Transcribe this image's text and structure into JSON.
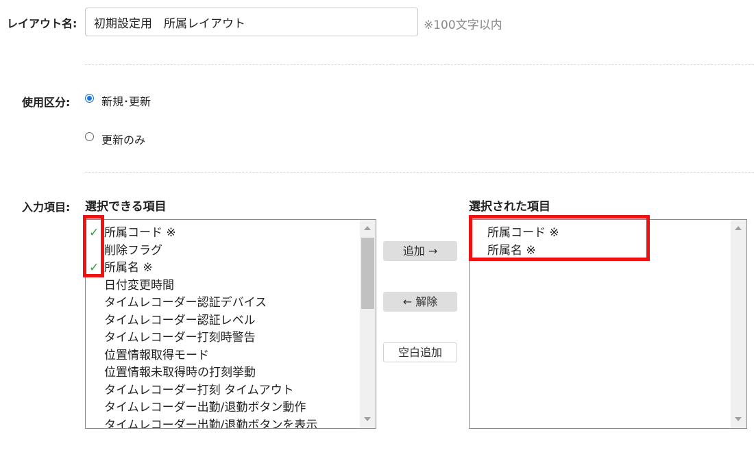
{
  "layout_name": {
    "label": "レイアウト名:",
    "value": "初期設定用　所属レイアウト",
    "hint": "※100文字以内"
  },
  "usage": {
    "label": "使用区分:",
    "options": [
      {
        "label": "新規･更新",
        "checked": true
      },
      {
        "label": "更新のみ",
        "checked": false
      }
    ]
  },
  "input_items": {
    "label": "入力項目:",
    "available_heading": "選択できる項目",
    "selected_heading": "選択された項目",
    "available": [
      {
        "label": "所属コード ※",
        "checked": true
      },
      {
        "label": "削除フラグ",
        "checked": false
      },
      {
        "label": "所属名 ※",
        "checked": true
      },
      {
        "label": "日付変更時間",
        "checked": false
      },
      {
        "label": "タイムレコーダー認証デバイス",
        "checked": false
      },
      {
        "label": "タイムレコーダー認証レベル",
        "checked": false
      },
      {
        "label": "タイムレコーダー打刻時警告",
        "checked": false
      },
      {
        "label": "位置情報取得モード",
        "checked": false
      },
      {
        "label": "位置情報未取得時の打刻挙動",
        "checked": false
      },
      {
        "label": "タイムレコーダー打刻 タイムアウト",
        "checked": false
      },
      {
        "label": "タイムレコーダー出勤/退勤ボタン動作",
        "checked": false
      },
      {
        "label": "タイムレコーダー出勤/退勤ボタンを表示",
        "checked": false
      }
    ],
    "selected": [
      "所属コード ※",
      "所属名 ※"
    ],
    "buttons": {
      "add": "追加 →",
      "remove": "← 解除",
      "add_blank": "空白追加"
    }
  },
  "colors": {
    "highlight": "#ee1111",
    "check": "#2e9e3a",
    "radio_selected": "#1a73e8"
  }
}
